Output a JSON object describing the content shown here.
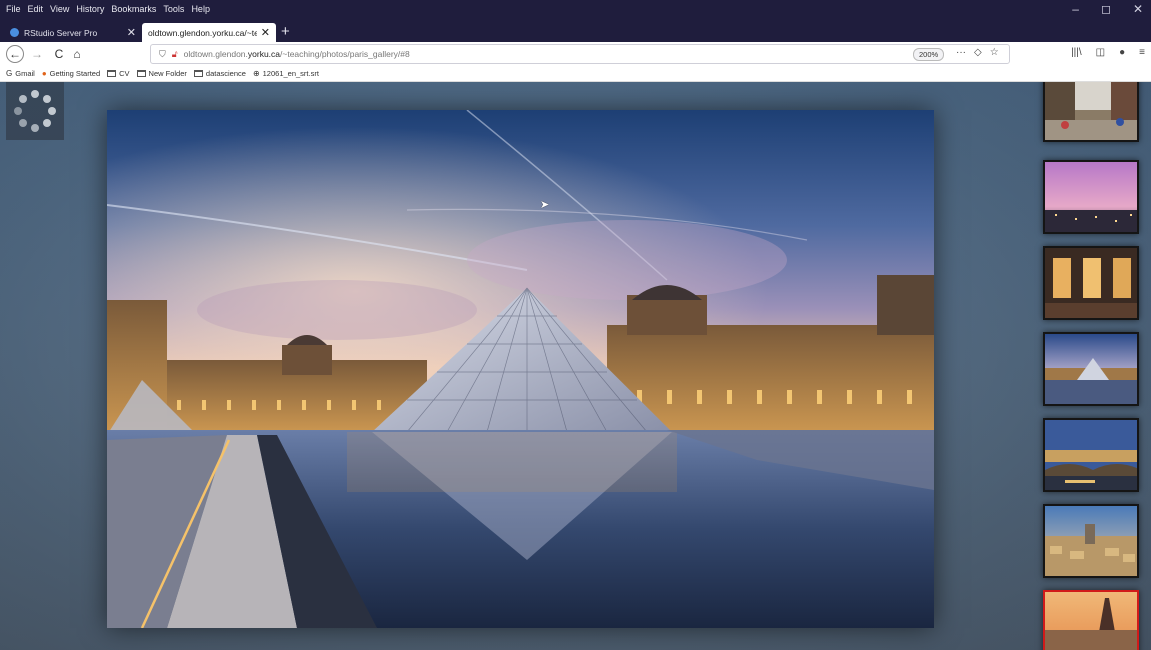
{
  "menu": [
    "File",
    "Edit",
    "View",
    "History",
    "Bookmarks",
    "Tools",
    "Help"
  ],
  "window_controls": {
    "minimize": "–",
    "maximize": "◻",
    "close": "✕"
  },
  "tabs": [
    {
      "title": "RStudio Server Pro",
      "close": "✕"
    },
    {
      "title": "oldtown.glendon.yorku.ca/~teachi",
      "close": "✕"
    }
  ],
  "new_tab": "+",
  "nav": {
    "back": "←",
    "forward": "→",
    "reload": "C",
    "home": "⌂"
  },
  "url": {
    "prefix": "oldtown.glendon.",
    "domain": "yorku.ca",
    "path": "/~teaching/photos/paris_gallery/#8"
  },
  "zoom": "200%",
  "url_actions": [
    "···",
    "◇",
    "☆"
  ],
  "right_tools": [
    "|||\\",
    "◫",
    "●",
    "≡"
  ],
  "bookmarks": [
    {
      "label": "Gmail",
      "icon": "G"
    },
    {
      "label": "Getting Started",
      "icon": "●"
    },
    {
      "label": "CV",
      "icon": "folder"
    },
    {
      "label": "New Folder",
      "icon": "folder"
    },
    {
      "label": "datascience",
      "icon": "folder"
    },
    {
      "label": "12061_en_srt.srt",
      "icon": "globe"
    }
  ],
  "gallery": {
    "current": "#8",
    "main_photo": "louvre-pyramid-dusk",
    "thumbnails": [
      {
        "subject": "paris-street-cafe",
        "selected": false
      },
      {
        "subject": "paris-skyline-purple-dusk",
        "selected": false
      },
      {
        "subject": "paris-restaurant-night",
        "selected": false
      },
      {
        "subject": "louvre-pyramid",
        "selected": false
      },
      {
        "subject": "seine-bridge-evening",
        "selected": false
      },
      {
        "subject": "paris-aerial-view",
        "selected": false
      },
      {
        "subject": "eiffel-tower-sunset",
        "selected": true
      }
    ]
  },
  "colors": {
    "chrome_dark": "#1f1d3d",
    "selected_border": "#d11a1a"
  }
}
